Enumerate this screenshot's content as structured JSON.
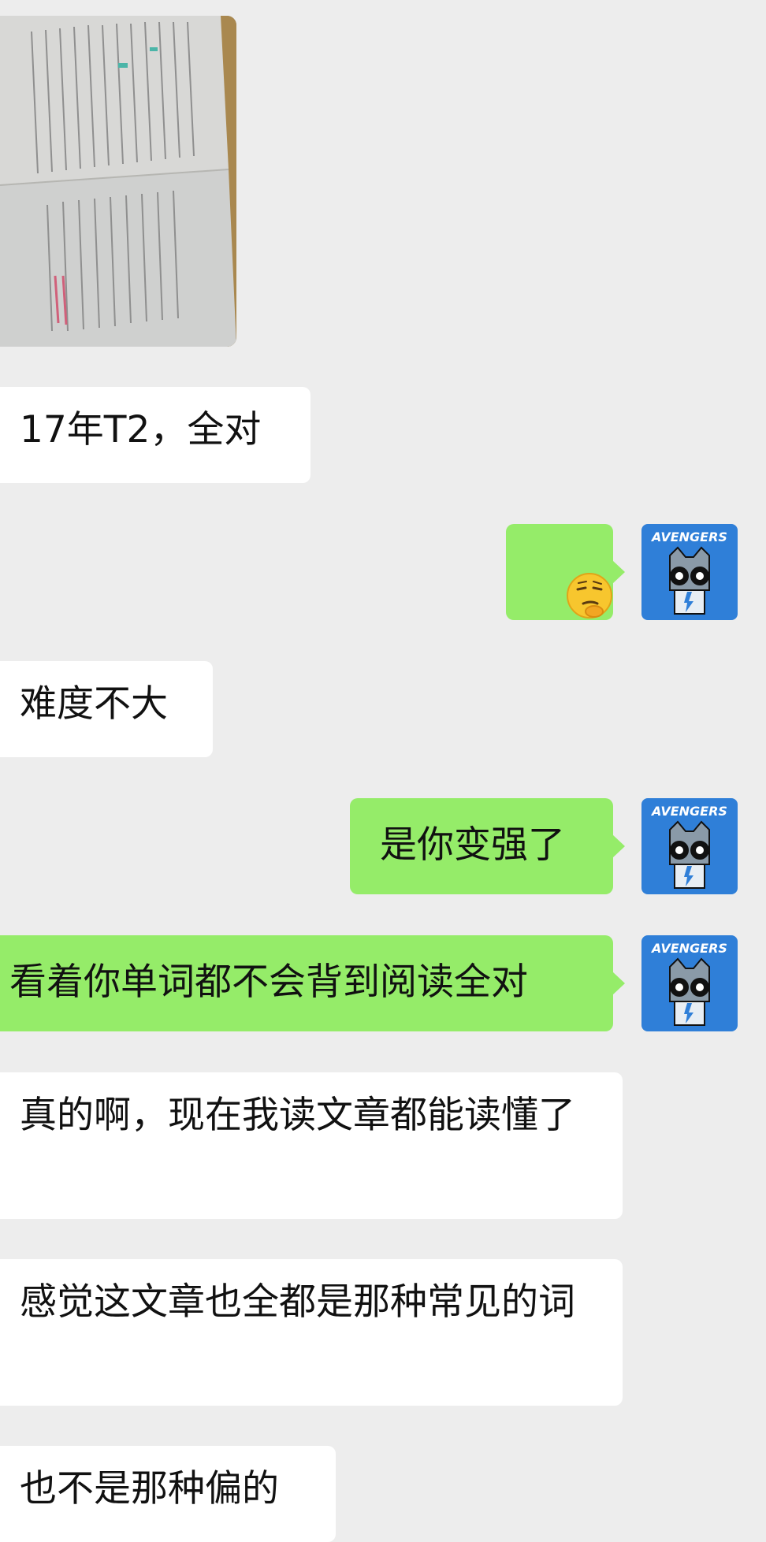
{
  "messages": [
    {
      "kind": "image",
      "side": "left"
    },
    {
      "kind": "text",
      "side": "left",
      "text": "17年T2，全对"
    },
    {
      "kind": "emoji",
      "side": "right",
      "emoji": "thinking-squint-emoji"
    },
    {
      "kind": "text",
      "side": "left",
      "text": "难度不大"
    },
    {
      "kind": "text",
      "side": "right",
      "text": "是你变强了"
    },
    {
      "kind": "text",
      "side": "right",
      "text": "看着你单词都不会背到阅读全对"
    },
    {
      "kind": "text",
      "side": "left",
      "text": "真的啊，现在我读文章都能读懂了"
    },
    {
      "kind": "text",
      "side": "left",
      "text": "感觉这文章也全都是那种常见的词"
    },
    {
      "kind": "text",
      "side": "left",
      "text": "也不是那种偏的"
    }
  ],
  "avatar": {
    "logo_text": "AVENGERS",
    "bg_color": "#2f7fd8"
  },
  "colors": {
    "background": "#ededed",
    "incoming_bubble": "#ffffff",
    "outgoing_bubble": "#95ec69"
  }
}
